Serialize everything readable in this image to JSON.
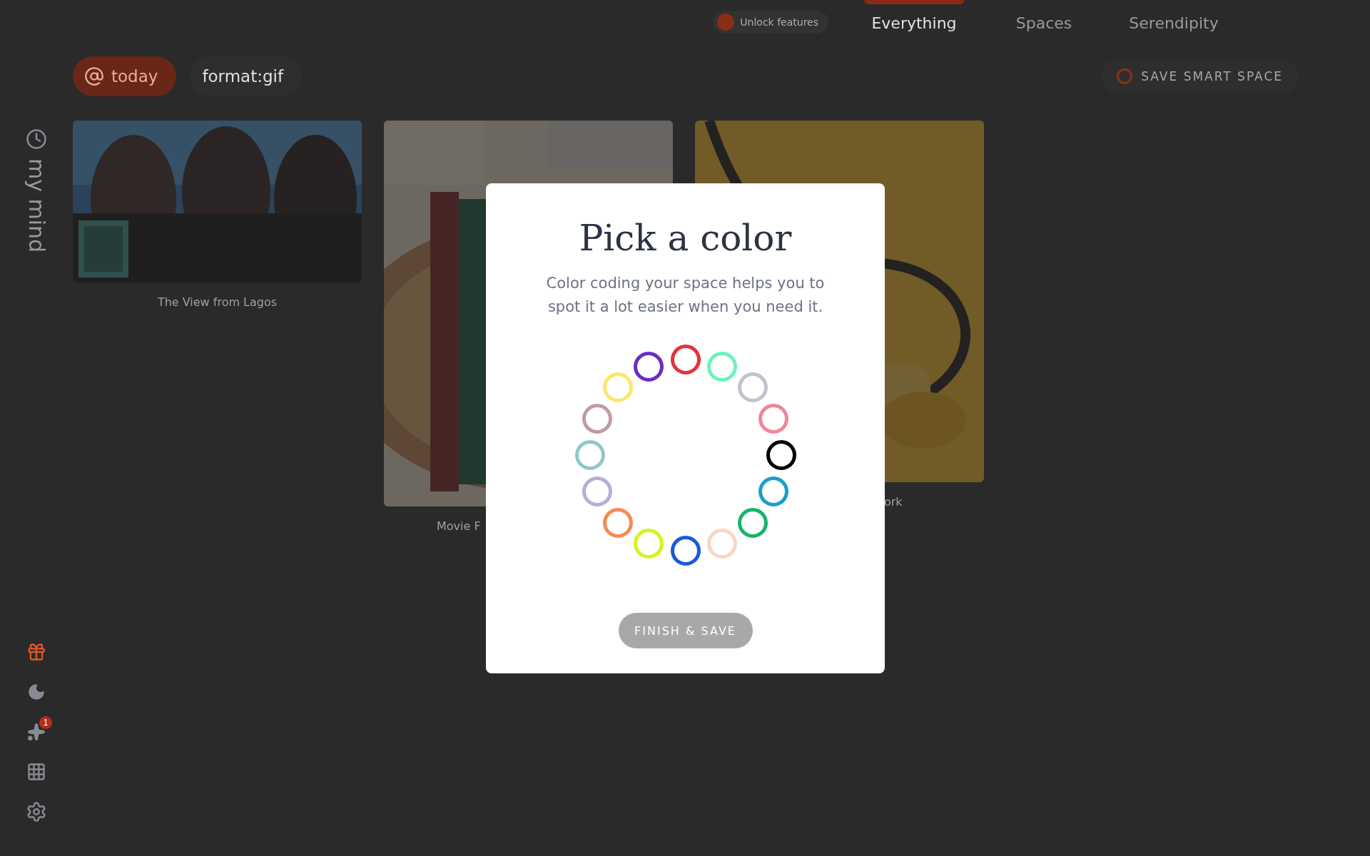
{
  "top_bar": {
    "unlock": {
      "label": "Unlock features"
    },
    "tabs": [
      {
        "label": "Everything",
        "selected": true
      },
      {
        "label": "Spaces",
        "selected": false
      },
      {
        "label": "Serendipity",
        "selected": false
      }
    ]
  },
  "filters": {
    "chips": [
      {
        "label": "today",
        "kind": "date"
      },
      {
        "label": "format:gif",
        "kind": "text"
      }
    ],
    "save_button": {
      "label": "SAVE SMART SPACE"
    }
  },
  "sidebar": {
    "title": "my mind",
    "tools": [
      {
        "kind": "gift"
      },
      {
        "kind": "moon"
      },
      {
        "kind": "sparkles",
        "badge": "1"
      },
      {
        "kind": "grid"
      },
      {
        "kind": "settings"
      }
    ]
  },
  "cards": [
    {
      "kind": "picture",
      "caption": "The View from Lagos"
    },
    {
      "kind": "picture",
      "caption": "Movie F"
    },
    {
      "kind": "picture",
      "caption": "ork"
    }
  ],
  "dialog": {
    "title": "Pick a color",
    "text": "Color coding your space helps you to spot it a lot easier when you need it.",
    "colors": [
      {
        "color": "#e0343f"
      },
      {
        "color": "#6ef2bd"
      },
      {
        "color": "#c3c1cf"
      },
      {
        "color": "#f0869c"
      },
      {
        "color": "#000000"
      },
      {
        "color": "#1c9ec6"
      },
      {
        "color": "#19b368"
      },
      {
        "color": "#fad5c7"
      },
      {
        "color": "#1858e0"
      },
      {
        "color": "#d4f51c"
      },
      {
        "color": "#f58b54"
      },
      {
        "color": "#b9acd8"
      },
      {
        "color": "#8ec8cb"
      },
      {
        "color": "#c19aa6"
      },
      {
        "color": "#fae86a"
      },
      {
        "color": "#6a2ec2"
      }
    ],
    "button": {
      "label": "FINISH & SAVE",
      "disabled": true
    }
  }
}
